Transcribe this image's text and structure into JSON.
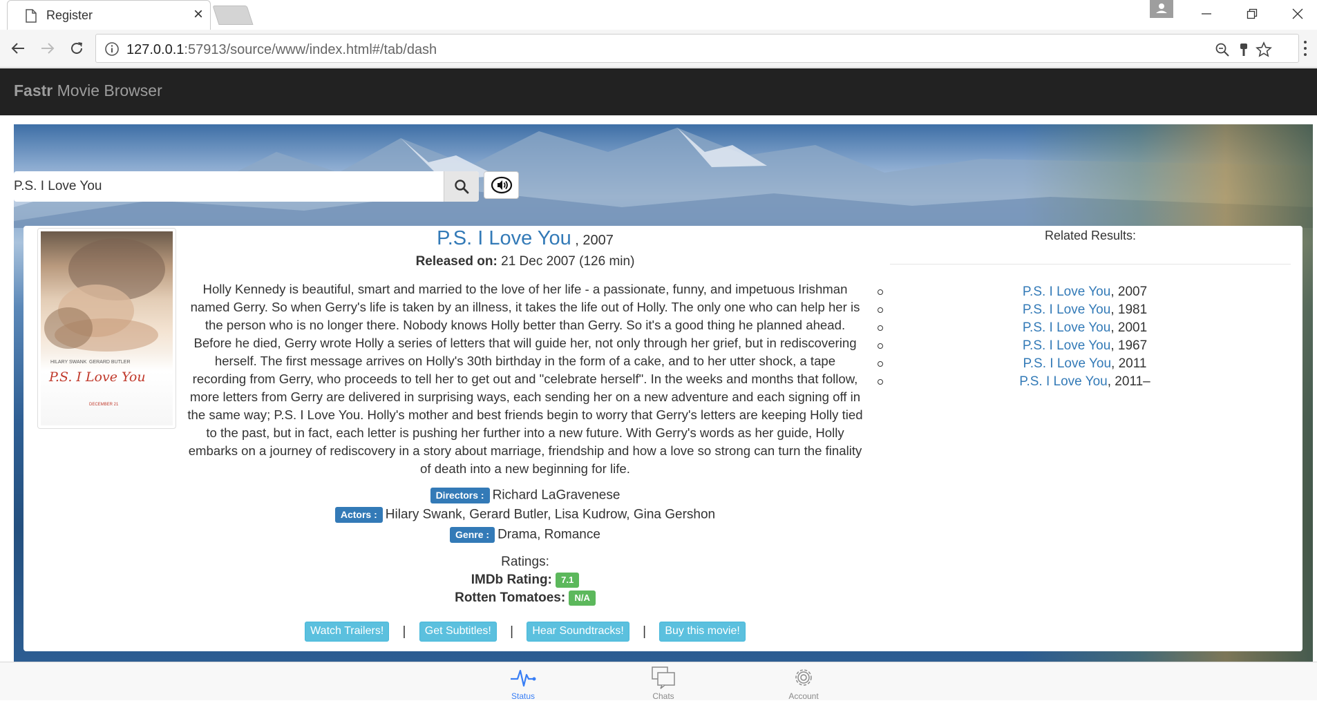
{
  "browser": {
    "tab_title": "Register",
    "tab_close": "×",
    "url_host": "127.0.0.1",
    "url_rest": ":57913/source/www/index.html#/tab/dash"
  },
  "app": {
    "brand_bold": "Fastr",
    "brand_rest": " Movie Browser"
  },
  "search": {
    "value": "P.S. I Love You",
    "placeholder": ""
  },
  "movie": {
    "title": "P.S. I Love You",
    "year": " , 2007",
    "released_label": "Released on:",
    "released_value": " 21 Dec 2007 (126 min)",
    "plot": "Holly Kennedy is beautiful, smart and married to the love of her life - a passionate, funny, and impetuous Irishman named Gerry. So when Gerry's life is taken by an illness, it takes the life out of Holly. The only one who can help her is the person who is no longer there. Nobody knows Holly better than Gerry. So it's a good thing he planned ahead. Before he died, Gerry wrote Holly a series of letters that will guide her, not only through her grief, but in rediscovering herself. The first message arrives on Holly's 30th birthday in the form of a cake, and to her utter shock, a tape recording from Gerry, who proceeds to tell her to get out and \"celebrate herself\". In the weeks and months that follow, more letters from Gerry are delivered in surprising ways, each sending her on a new adventure and each signing off in the same way; P.S. I Love You. Holly's mother and best friends begin to worry that Gerry's letters are keeping Holly tied to the past, but in fact, each letter is pushing her further into a new future. With Gerry's words as her guide, Holly embarks on a journey of rediscovery in a story about marriage, friendship and how a love so strong can turn the finality of death into a new beginning for life.",
    "directors_label": "Directors :",
    "directors": "Richard LaGravenese",
    "actors_label": "Actors :",
    "actors": "Hilary Swank, Gerard Butler, Lisa Kudrow, Gina Gershon",
    "genre_label": "Genre :",
    "genre": "Drama, Romance",
    "ratings_heading": "Ratings:",
    "imdb_label": "IMDb Rating:",
    "imdb_value": "7.1",
    "rt_label": "Rotten Tomatoes:",
    "rt_value": "N/A",
    "poster_actor_1": "HILARY SWANK",
    "poster_actor_2": "GERARD BUTLER",
    "poster_title": "P.S. I Love You",
    "poster_date": "DECEMBER 21"
  },
  "actions": {
    "trailers": "Watch Trailers!",
    "subtitles": "Get Subtitles!",
    "soundtracks": "Hear Soundtracks!",
    "buy": "Buy this movie!",
    "separator": "|"
  },
  "related": {
    "heading": "Related Results:",
    "items": [
      {
        "title": "P.S. I Love You",
        "year": ", 2007"
      },
      {
        "title": "P.S. I Love You",
        "year": ", 1981"
      },
      {
        "title": "P.S. I Love You",
        "year": ", 2001"
      },
      {
        "title": "P.S. I Love You",
        "year": ", 1967"
      },
      {
        "title": "P.S. I Love You",
        "year": ", 2011"
      },
      {
        "title": "P.S. I Love You",
        "year": ", 2011–"
      }
    ]
  },
  "tabbar": {
    "items": [
      {
        "label": "Status",
        "icon": "pulse-icon",
        "active": true
      },
      {
        "label": "Chats",
        "icon": "chat-bubbles-icon",
        "active": false
      },
      {
        "label": "Account",
        "icon": "gear-icon",
        "active": false
      }
    ]
  },
  "colors": {
    "navbar": "#222222",
    "link": "#337ab7",
    "label_primary": "#337ab7",
    "label_success": "#5cb85c",
    "btn_info": "#5bc0de",
    "tab_active": "#387ef5"
  }
}
